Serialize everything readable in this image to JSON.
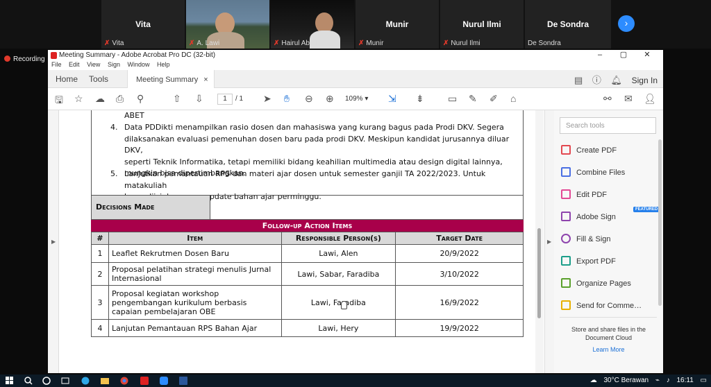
{
  "zoom": {
    "participants": [
      {
        "big_name": "Vita",
        "label": "Vita",
        "muted": true
      },
      {
        "big_name": "",
        "label": "A. Lawi",
        "muted": true
      },
      {
        "big_name": "",
        "label": "Hairul Abral",
        "muted": true
      },
      {
        "big_name": "Munir",
        "label": "Munir",
        "muted": true
      },
      {
        "big_name": "Nurul Ilmi",
        "label": "Nurul Ilmi",
        "muted": true
      },
      {
        "big_name": "De Sondra",
        "label": "De Sondra",
        "muted": false
      }
    ],
    "recording": "Recording",
    "next_icon": "chevron-right-icon"
  },
  "acrobat": {
    "title": "Meeting Summary - Adobe Acrobat Pro DC (32-bit)",
    "menu": [
      "File",
      "Edit",
      "View",
      "Sign",
      "Window",
      "Help"
    ],
    "tabs": {
      "home": "Home",
      "tools": "Tools",
      "doc": "Meeting Summary",
      "close": "×"
    },
    "sign_in": "Sign In",
    "page_current": "1",
    "page_total": "/ 1",
    "zoom": "109%",
    "window_controls": [
      "–",
      "▢",
      "✕"
    ]
  },
  "document": {
    "abet": "ABET",
    "items": [
      {
        "num": "4.",
        "lines": [
          "Data PDDikti menampilkan rasio dosen dan mahasiswa yang kurang bagus pada Prodi DKV. Segera",
          "dilaksanakan evaluasi pemenuhan dosen baru pada prodi DKV. Meskipun kandidat jurusannya diluar DKV,",
          "seperti Teknik Informatika, tetapi memiliki bidang keahilian multimedia atau design digital lainnya,",
          "mungkin bisa dipertimbangkan."
        ]
      },
      {
        "num": "5.",
        "lines": [
          "Lanjutkan pemantauan RPS dan materi ajar dosen untuk semester ganjil TA 2022/2023. Untuk matakuliah",
          "baru, diizinkan mengupdate bahan ajar perminggu."
        ]
      }
    ],
    "decisions_label": "Decisions Made",
    "action_title": "Follow-up Action Items",
    "columns": [
      "#",
      "Item",
      "Responsible Person(s)",
      "Target Date"
    ],
    "rows": [
      {
        "num": "1",
        "item": "Leaflet Rekrutmen Dosen Baru",
        "person": "Lawi, Alen",
        "date": "20/9/2022"
      },
      {
        "num": "2",
        "item": "Proposal pelatihan strategi menulis Jurnal Internasional",
        "person": "Lawi, Sabar, Faradiba",
        "date": "3/10/2022"
      },
      {
        "num": "3",
        "item": "Proposal kegiatan workshop pengembangan kurikulum berbasis capaian pembelajaran OBE",
        "person": "Lawi, Faradiba",
        "date": "16/9/2022"
      },
      {
        "num": "4",
        "item": "Lanjutan Pemantauan RPS  Bahan Ajar",
        "person": "Lawi, Hery",
        "date": "19/9/2022"
      }
    ]
  },
  "tools_pane": {
    "search_placeholder": "Search tools",
    "tools": [
      {
        "label": "Create PDF",
        "color": "#e34850"
      },
      {
        "label": "Combine Files",
        "color": "#4a6fe3"
      },
      {
        "label": "Edit PDF",
        "color": "#e34894"
      },
      {
        "label": "Adobe Sign",
        "color": "#8e44ad"
      },
      {
        "label": "Fill & Sign",
        "color": "#8e44ad"
      },
      {
        "label": "Export PDF",
        "color": "#1c9e8a"
      },
      {
        "label": "Organize Pages",
        "color": "#5aa02c"
      },
      {
        "label": "Send for Comme…",
        "color": "#e8b000"
      }
    ],
    "featured": "FEATURED",
    "promo_lines": [
      "Store and share files in the",
      "Document Cloud"
    ],
    "learn_more": "Learn More"
  },
  "taskbar": {
    "weather": "30°C  Berawan",
    "time": "16:11"
  },
  "colors": {
    "accent": "#a8004a",
    "zoom_blue": "#2d8cff",
    "header_gray": "#d9d9d9"
  }
}
